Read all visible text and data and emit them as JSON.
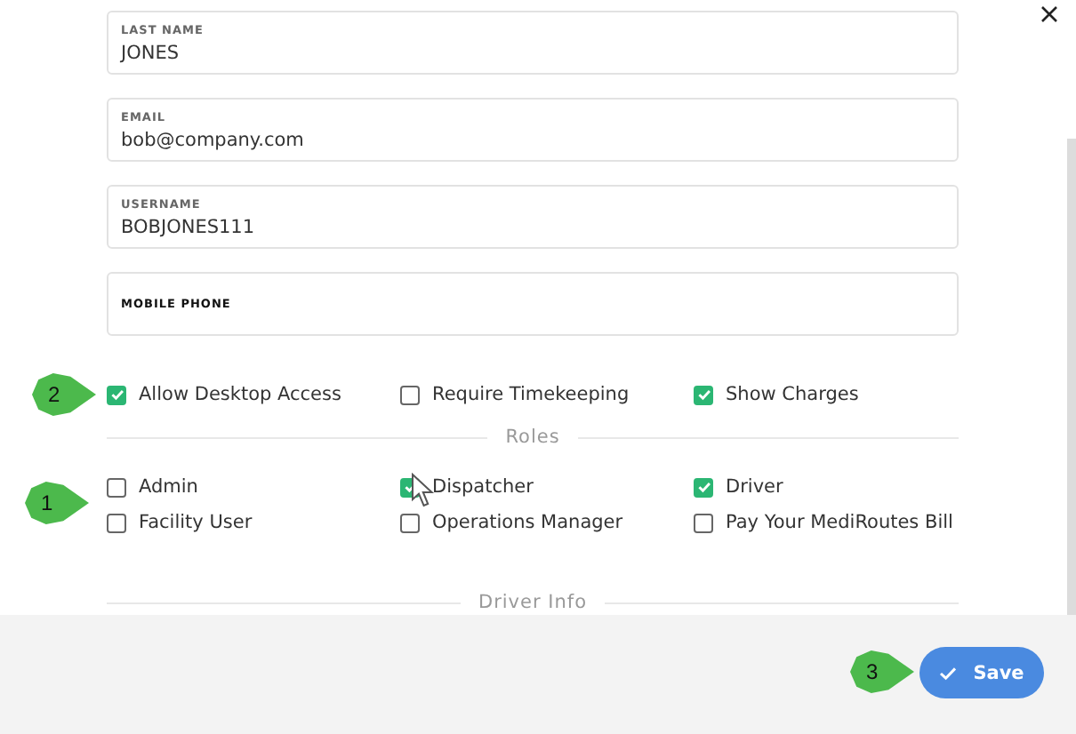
{
  "fields": [
    {
      "label": "LAST NAME",
      "value": "JONES"
    },
    {
      "label": "EMAIL",
      "value": "bob@company.com"
    },
    {
      "label": "USERNAME",
      "value": "BOBJONES111"
    },
    {
      "label": "MOBILE PHONE"
    }
  ],
  "options_callout": "2",
  "options": [
    {
      "label": "Allow Desktop Access",
      "checked": true
    },
    {
      "label": "Require Timekeeping",
      "checked": false
    },
    {
      "label": "Show Charges",
      "checked": true
    }
  ],
  "roles_heading": "Roles",
  "roles_callout": "1",
  "roles": [
    {
      "label": "Admin",
      "checked": false
    },
    {
      "label": "Dispatcher",
      "checked": true
    },
    {
      "label": "Driver",
      "checked": true
    },
    {
      "label": "Facility User",
      "checked": false
    },
    {
      "label": "Operations Manager",
      "checked": false
    },
    {
      "label": "Pay Your MediRoutes Bill",
      "checked": false
    }
  ],
  "driver_info_heading": "Driver Info",
  "save_callout": "3",
  "save_button": {
    "label": "Save"
  }
}
